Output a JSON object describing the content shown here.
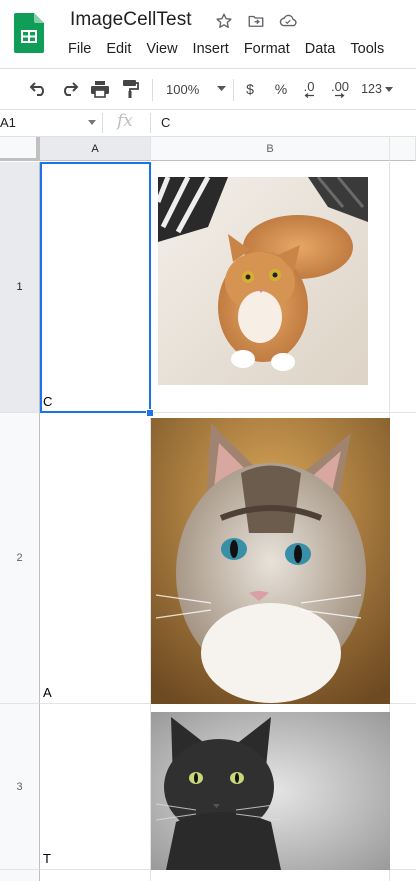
{
  "document": {
    "title": "ImageCellTest"
  },
  "menu": [
    "File",
    "Edit",
    "View",
    "Insert",
    "Format",
    "Data",
    "Tools"
  ],
  "toolbar": {
    "zoom": "100%",
    "currency": "$",
    "percent": "%",
    "decrease_decimals": ".0",
    "increase_decimals": ".00",
    "more_formats": "123"
  },
  "formula_bar": {
    "cell_ref": "A1",
    "fx": "fx",
    "value": "C"
  },
  "grid": {
    "columns": [
      "A",
      "B"
    ],
    "rows": [
      {
        "number": "1",
        "a": "C",
        "b_image": "orange tabby cat on bed"
      },
      {
        "number": "2",
        "a": "A",
        "b_image": "tabby-white cat with blue eyes"
      },
      {
        "number": "3",
        "a": "T",
        "b_image": "black cat with green eyes"
      }
    ]
  },
  "colors": {
    "accent": "#1a73e8",
    "sheets_green": "#0f9d58"
  }
}
